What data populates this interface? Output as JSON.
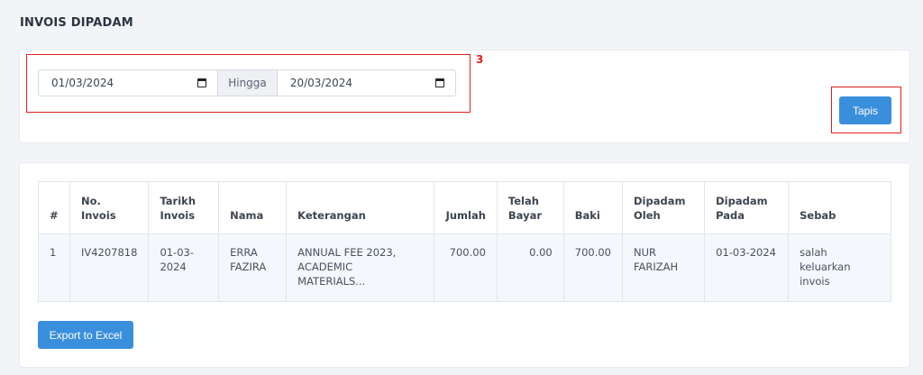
{
  "page_title": "INVOIS DIPADAM",
  "filter": {
    "date_from": "01/03/2024",
    "separator": "Hingga",
    "date_to": "20/03/2024",
    "submit_label": "Tapis"
  },
  "annotation": {
    "label": "3",
    "color": "#e02020"
  },
  "table": {
    "headers": {
      "index": "#",
      "invoice_no": "No. Invois",
      "invoice_date": "Tarikh Invois",
      "name": "Nama",
      "description": "Keterangan",
      "amount": "Jumlah",
      "paid": "Telah Bayar",
      "balance": "Baki",
      "deleted_by": "Dipadam Oleh",
      "deleted_on": "Dipadam Pada",
      "reason": "Sebab"
    },
    "rows": [
      {
        "index": "1",
        "invoice_no": "IV4207818",
        "invoice_date": "01-03-2024",
        "name": "ERRA FAZIRA",
        "description": "ANNUAL FEE 2023, ACADEMIC MATERIALS...",
        "amount": "700.00",
        "paid": "0.00",
        "balance": "700.00",
        "deleted_by": "NUR FARIZAH",
        "deleted_on": "01-03-2024",
        "reason": "salah keluarkan invois"
      }
    ]
  },
  "export_label": "Export to Excel",
  "colors": {
    "primary_button": "#3a8fdc",
    "annotation": "#e02020"
  }
}
